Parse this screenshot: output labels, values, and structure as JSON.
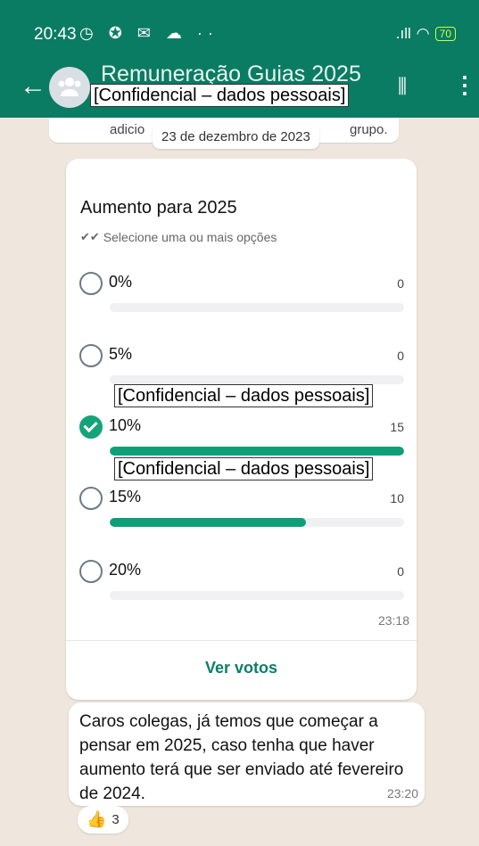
{
  "status_bar": {
    "time": "20:43",
    "left_icons": "◷ ✪ ✉ ☁ ··",
    "signal": ".ıll",
    "wifi": "◠",
    "battery": "70"
  },
  "header": {
    "title": "Remuneração Guias  2025",
    "redacted_subtitle": "[Confidencial – dados pessoais]"
  },
  "chat": {
    "system_message_left": "adicio",
    "system_message_right": "grupo.",
    "date_chip": "23 de dezembro de 2023"
  },
  "poll": {
    "title": "Aumento para 2025",
    "subtitle": "Selecione uma ou mais opções",
    "options": [
      {
        "label": "0%",
        "votes": "0",
        "checked": false,
        "fill_fraction": 0
      },
      {
        "label": "5%",
        "votes": "0",
        "checked": false,
        "fill_fraction": 0
      },
      {
        "label": "10%",
        "votes": "15",
        "checked": true,
        "fill_fraction": 1
      },
      {
        "label": "15%",
        "votes": "10",
        "checked": false,
        "fill_fraction": 0.667
      },
      {
        "label": "20%",
        "votes": "0",
        "checked": false,
        "fill_fraction": 0
      }
    ],
    "time": "23:18",
    "see_votes": "Ver votos",
    "redacted_voters_10": "[Confidencial – dados pessoais]",
    "redacted_voters_15": "[Confidencial – dados pessoais]"
  },
  "message": {
    "text": "Caros colegas, já temos que começar a pensar em 2025, caso tenha que haver aumento terá que ser enviado até fevereiro de 2024.",
    "time": "23:20"
  },
  "reaction": {
    "emoji": "👍",
    "count": "3"
  },
  "colors": {
    "header": "#0a7c63",
    "accent": "#0e9f79",
    "chat_background": "#efe7de"
  }
}
